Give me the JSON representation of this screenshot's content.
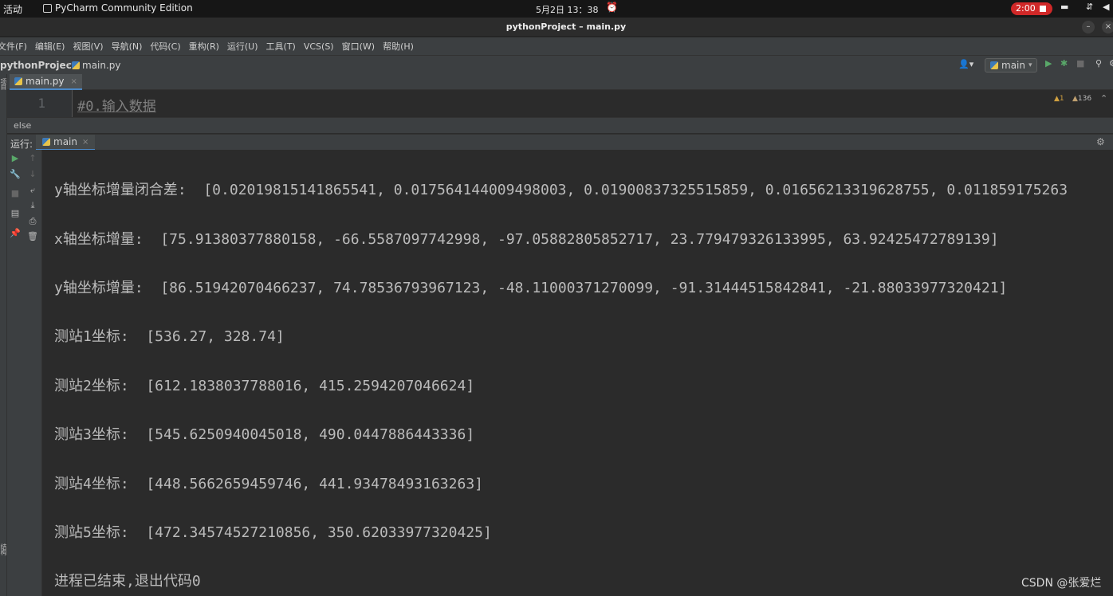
{
  "topbar": {
    "activities": "活动",
    "app_name": "PyCharm Community Edition",
    "clock": "5月2日  13：38",
    "recording": "2:00"
  },
  "window": {
    "title": "pythonProject – main.py"
  },
  "menu": [
    "文件(F)",
    "编辑(E)",
    "视图(V)",
    "导航(N)",
    "代码(C)",
    "重构(R)",
    "运行(U)",
    "工具(T)",
    "VCS(S)",
    "窗口(W)",
    "帮助(H)"
  ],
  "nav": {
    "project": "pythonProject",
    "file": "main.py",
    "run_config": "main"
  },
  "editor": {
    "tab": "main.py",
    "line_number": "1",
    "code": "#0.输入数据",
    "warnings": "1",
    "weak_warnings": "136"
  },
  "breadcrumb": "else",
  "run": {
    "label": "运行:",
    "tab": "main"
  },
  "console": {
    "lines": [
      "y轴坐标增量闭合差:  [0.02019815141865541, 0.01756414400949800З, 0.01900837325515859, 0.01656213319628755, 0.011859175263",
      "x轴坐标增量:  [75.91380377880158, -66.5587097742998, -97.05882805852717, 23.779479326133995, 63.92425472789139]",
      "y轴坐标增量:  [86.51942070466237, 74.78536793967123, -48.11000371270099, -91.31444515842841, -21.88033977320421]",
      "测站1坐标:  [536.27, 328.74]",
      "测站2坐标:  [612.1838037788016, 415.2594207046624]",
      "测站3坐标:  [545.6250940045018, 490.0447886443336]",
      "测站4坐标:  [448.5662659459746, 441.93478493163263]",
      "测站5坐标:  [472.34574527210856, 350.62033977320425]",
      "进程已结束,退出代码0"
    ]
  },
  "watermark": "CSDN @张爱烂",
  "colors": {
    "console_bg": "#2b2b2b",
    "panel_bg": "#3c3f41",
    "accent": "#4a88c7",
    "run_green": "#59a869",
    "record_red": "#d02828"
  }
}
